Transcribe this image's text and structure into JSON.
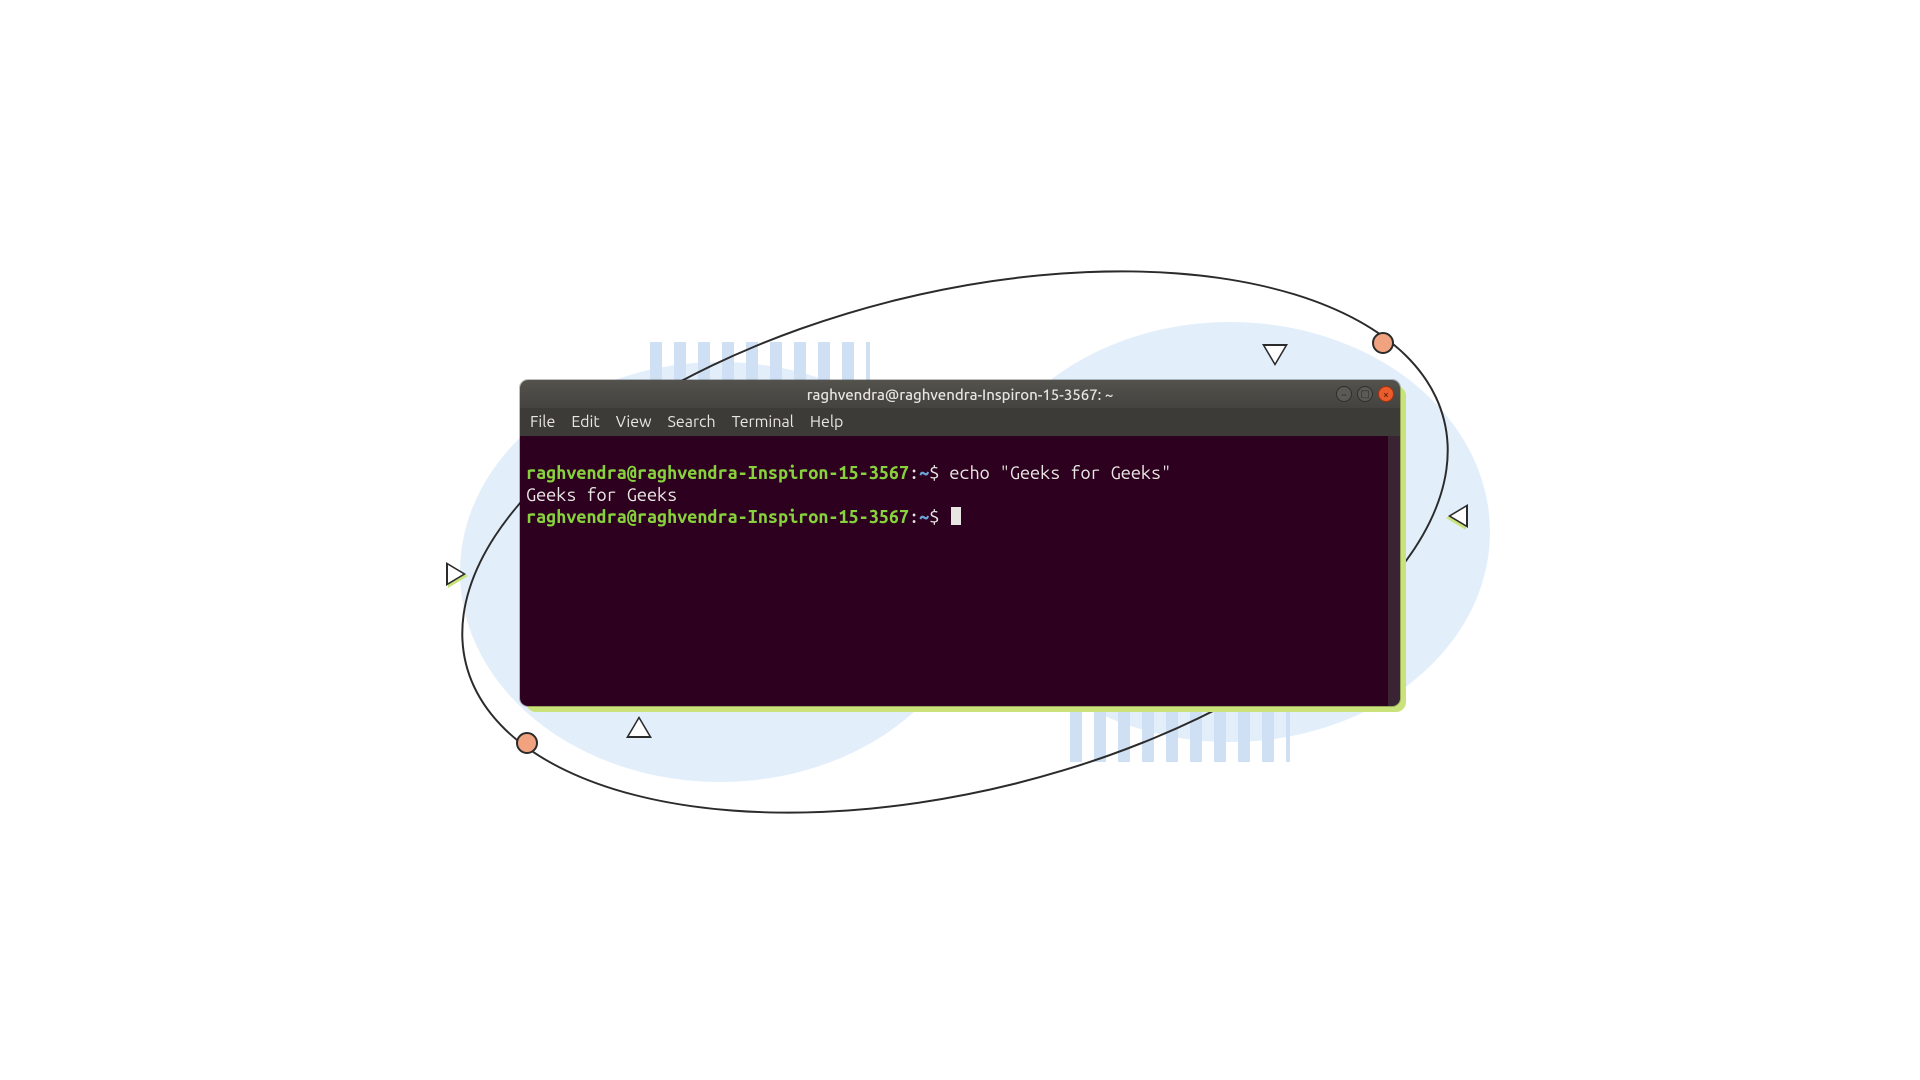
{
  "window": {
    "title": "raghvendra@raghvendra-Inspiron-15-3567: ~"
  },
  "menubar": {
    "items": [
      "File",
      "Edit",
      "View",
      "Search",
      "Terminal",
      "Help"
    ]
  },
  "terminal": {
    "lines": [
      {
        "type": "prompt",
        "user_host": "raghvendra@raghvendra-Inspiron-15-3567",
        "sep": ":",
        "path": "~",
        "dollar": "$ ",
        "command": "echo \"Geeks for Geeks\""
      },
      {
        "type": "output",
        "text": "Geeks for Geeks"
      },
      {
        "type": "prompt",
        "user_host": "raghvendra@raghvendra-Inspiron-15-3567",
        "sep": ":",
        "path": "~",
        "dollar": "$ ",
        "command": ""
      }
    ]
  }
}
